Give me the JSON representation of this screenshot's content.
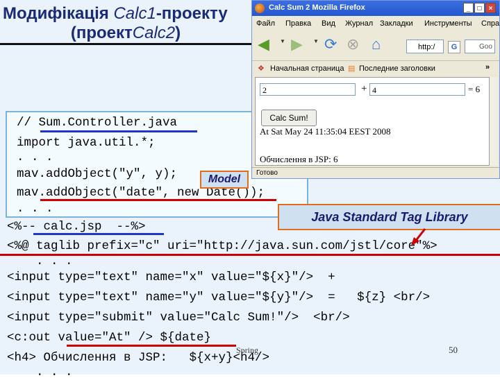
{
  "slide": {
    "title_line1_a": "Модифікація ",
    "title_line1_b": "Calc1",
    "title_line1_c": "-проекту",
    "title_line2_a": "(проект",
    "title_line2_b": "Calc2",
    "title_line2_c": ")",
    "footer_spring": "Spring",
    "footer_page": "50"
  },
  "code": {
    "lines": [
      "// Sum.Controller.java",
      "import java.util.*;",
      ". . .",
      "mav.addObject(\"y\", y);",
      "mav.addObject(\"date\", new Date());",
      ". . .",
      "<%-- calc.jsp  --%>",
      "<%@ taglib prefix=\"c\" uri=\"http://java.sun.com/jstl/core\"%>",
      "    . . .",
      "<input type=\"text\" name=\"x\" value=\"${x}\"/>  +",
      "<input type=\"text\" name=\"y\" value=\"${y}\"/>  =   ${z} <br/>",
      "<input type=\"submit\" value=\"Calc Sum!\"/>  <br/>",
      "<c:out value=\"At\" /> ${date}",
      "<h4> Обчислення в JSP:   ${x+y}<h4/>",
      "    . . ."
    ]
  },
  "callouts": {
    "model": "Model",
    "jstl": "Java Standard Tag Library"
  },
  "browser": {
    "window_title": "Calc Sum  2  Mozilla Firefox",
    "menu": [
      "Файл",
      "Правка",
      "Вид",
      "Журнал",
      "Закладки",
      "Инструменты",
      "Спра"
    ],
    "url": "http:/",
    "search_text": "Goo",
    "bookmarks": [
      "Начальная страница",
      "Последние заголовки"
    ],
    "bookmarks_more": "»",
    "x_value": "2",
    "plus": "+",
    "y_value": "4",
    "result": "= 6",
    "submit_label": "Calc Sum!",
    "date_text": "At Sat May 24 11:35:04 EEST 2008",
    "jsp_text": "Обчислення в JSP: 6",
    "status": "Готово"
  },
  "colors": {
    "title": "#1a2a78",
    "underline_blue": "#1f36c8",
    "underline_red": "#d00000",
    "callout_border": "#e26d1a"
  }
}
